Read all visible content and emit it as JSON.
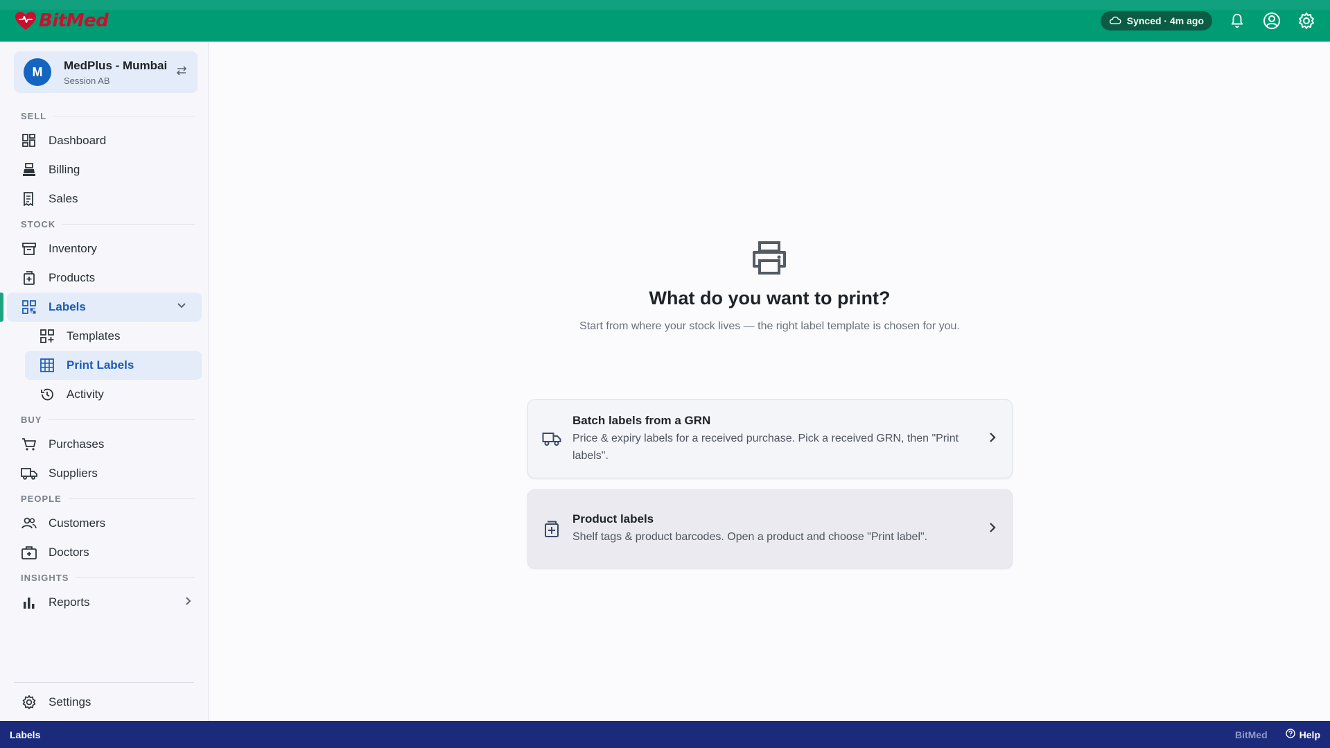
{
  "app": {
    "brand_name": "BitMed",
    "colors": {
      "topbar": "#009c74",
      "brand": "#c8102e",
      "accent": "#1c5cb8",
      "statusbar": "#1b2a7a"
    }
  },
  "topbar": {
    "sync_status": "Synced · 4m ago",
    "icons": [
      "cloud-icon",
      "bell-icon",
      "account-icon",
      "settings-gear-icon"
    ]
  },
  "org": {
    "initial": "M",
    "name": "MedPlus - Mumbai",
    "session": "Session AB"
  },
  "sidebar": {
    "sections": {
      "sell": "SELL",
      "stock": "STOCK",
      "buy": "BUY",
      "people": "PEOPLE",
      "insights": "INSIGHTS"
    },
    "items": {
      "dashboard": "Dashboard",
      "billing": "Billing",
      "sales": "Sales",
      "inventory": "Inventory",
      "products": "Products",
      "labels": "Labels",
      "templates": "Templates",
      "print_labels": "Print Labels",
      "activity": "Activity",
      "purchases": "Purchases",
      "suppliers": "Suppliers",
      "customers": "Customers",
      "doctors": "Doctors",
      "reports": "Reports",
      "settings": "Settings"
    }
  },
  "main": {
    "headline": "What do you want to print?",
    "subline": "Start from where your stock lives — the right label template is chosen for you.",
    "cards": [
      {
        "title": "Batch labels from a GRN",
        "description": "Price & expiry labels for a received purchase. Pick a received GRN, then \"Print labels\".",
        "icon": "truck-icon"
      },
      {
        "title": "Product labels",
        "description": "Shelf tags & product barcodes. Open a product and choose \"Print label\".",
        "icon": "medicine-box-icon"
      }
    ]
  },
  "statusbar": {
    "current": "Labels",
    "brand": "BitMed",
    "help": "Help"
  }
}
